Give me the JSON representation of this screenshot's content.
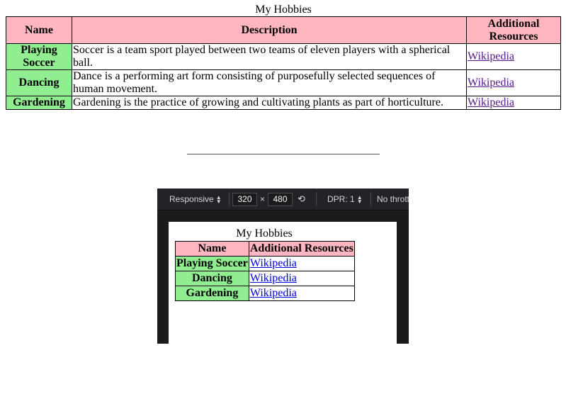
{
  "main": {
    "caption": "My Hobbies",
    "headers": {
      "name": "Name",
      "description": "Description",
      "resources": "Additional Resources"
    },
    "rows": [
      {
        "name": "Playing Soccer",
        "description": "Soccer is a team sport played between two teams of eleven players with a spherical ball.",
        "link": "Wikipedia"
      },
      {
        "name": "Dancing",
        "description": "Dance is a performing art form consisting of purposefully selected sequences of human movement.",
        "link": "Wikipedia"
      },
      {
        "name": "Gardening",
        "description": "Gardening is the practice of growing and cultivating plants as part of horticulture.",
        "link": "Wikipedia"
      }
    ]
  },
  "devtools": {
    "device": "Responsive",
    "width": "320",
    "times": "×",
    "height": "480",
    "dpr": "DPR: 1",
    "throttle": "No throttling"
  },
  "mobile": {
    "caption": "My Hobbies",
    "headers": {
      "name": "Name",
      "resources": "Additional Resources"
    },
    "rows": [
      {
        "name": "Playing Soccer",
        "link": "Wikipedia"
      },
      {
        "name": "Dancing",
        "link": "Wikipedia"
      },
      {
        "name": "Gardening",
        "link": "Wikipedia"
      }
    ]
  },
  "colors": {
    "header_bg": "#ffb6c1",
    "rowhead_bg": "#90ee90",
    "visited_link": "#551a8b",
    "link": "#0000ee",
    "devtools_bg": "#232327"
  }
}
